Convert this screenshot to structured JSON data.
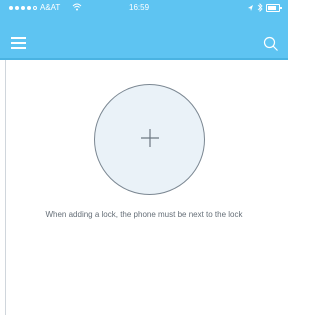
{
  "status": {
    "carrier": "A&AT",
    "time": "16:59",
    "signal_bars": 5,
    "signal_filled": 4,
    "battery_level": 0.8
  },
  "header": {
    "menu_icon": "hamburger-menu-icon",
    "search_icon": "search-icon",
    "accent": "#5ec4f2"
  },
  "main": {
    "add_button_icon": "plus-icon",
    "hint": "When adding a lock, the phone must be next to the lock"
  }
}
